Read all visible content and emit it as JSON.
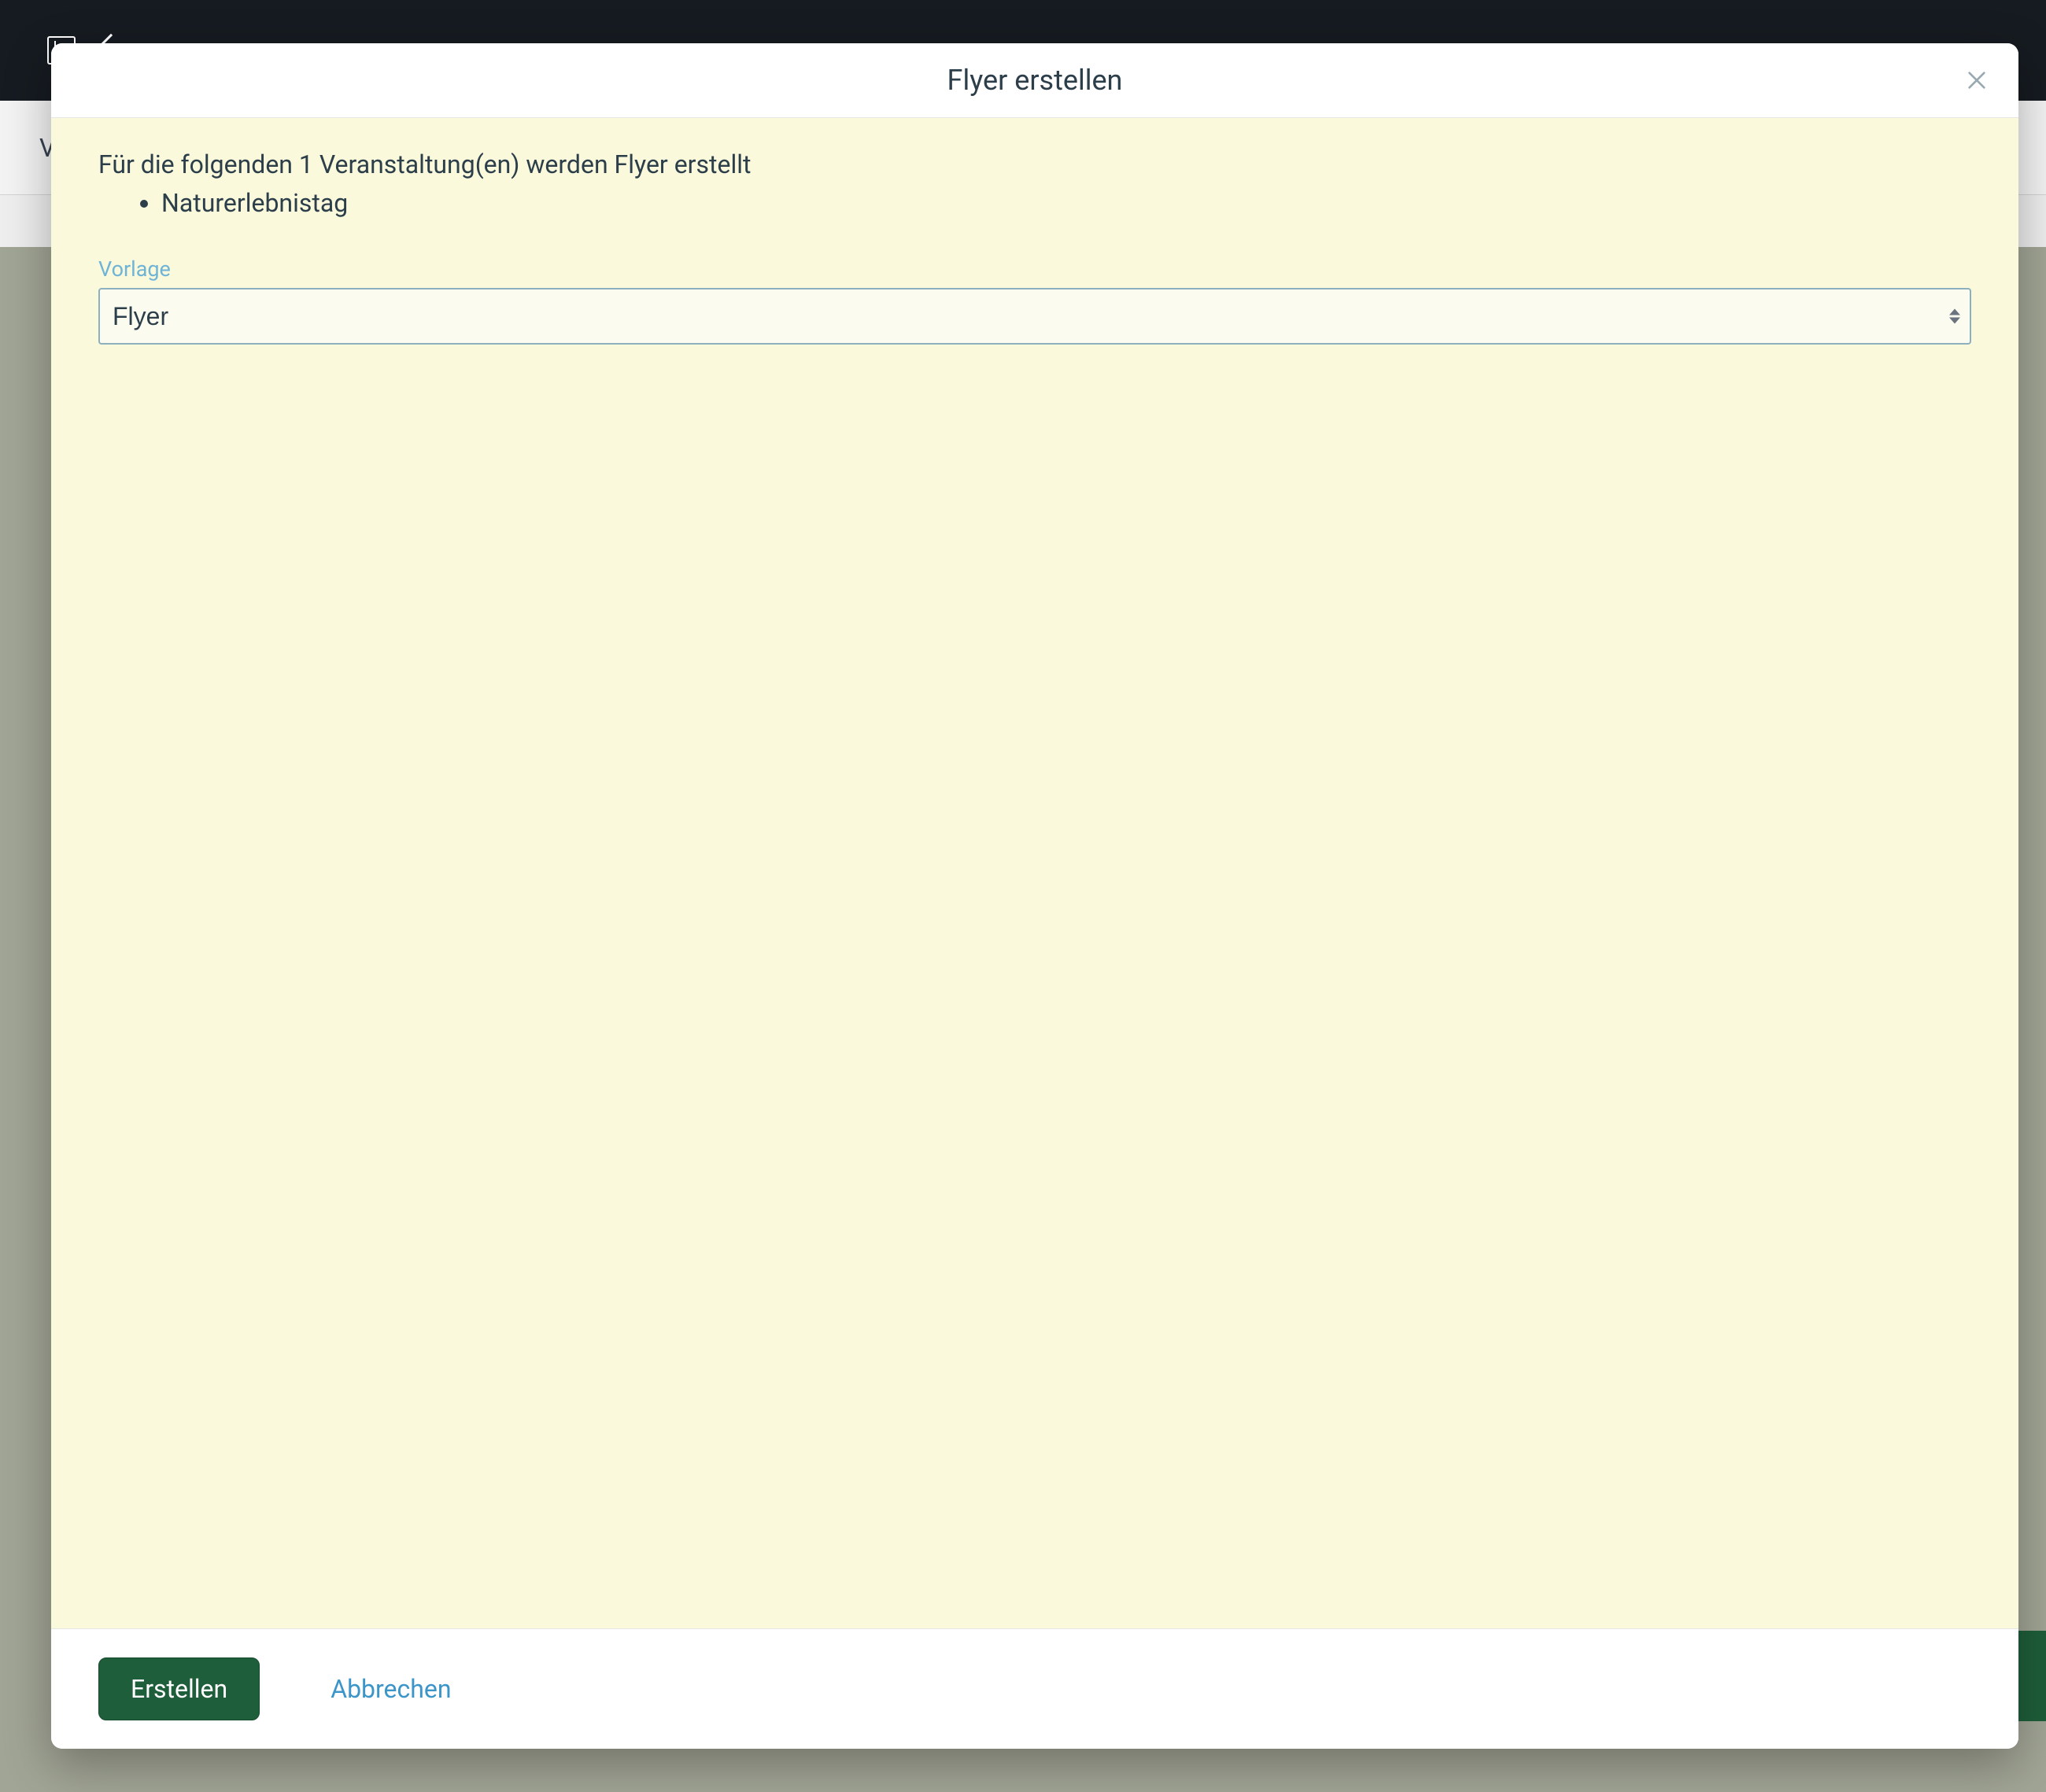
{
  "background": {
    "secondaryLeft": "V",
    "titlePartial": ""
  },
  "modal": {
    "title": "Flyer erstellen",
    "introText": "Für die folgenden 1 Veranstaltung(en) werden Flyer erstellt",
    "events": [
      "Naturerlebnistag"
    ],
    "template": {
      "label": "Vorlage",
      "selected": "Flyer",
      "options": [
        "Flyer"
      ]
    },
    "footer": {
      "primary": "Erstellen",
      "cancel": "Abbrechen"
    }
  }
}
